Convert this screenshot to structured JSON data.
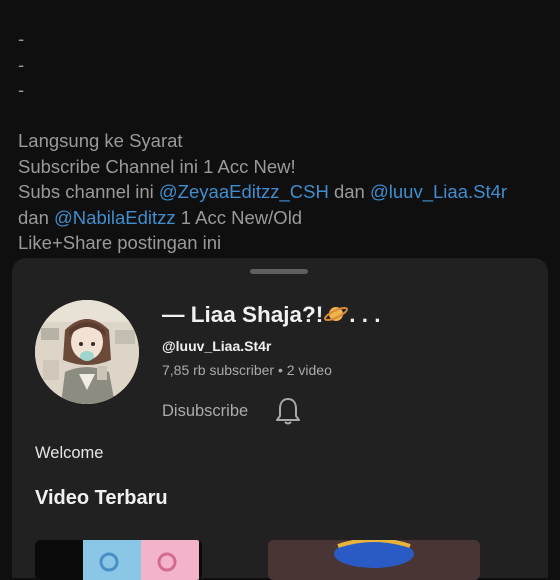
{
  "post": {
    "dashes": [
      "-",
      "-",
      "-"
    ],
    "line1": "Langsung ke Syarat",
    "line2": "Subscribe Channel ini 1 Acc New!",
    "line3_prefix": "Subs channel ini ",
    "mention1": "@ZeyaaEditzz_CSH",
    "line3_mid": " dan ",
    "mention2": "@luuv_Liaa.St4r",
    "line4_prefix": "dan ",
    "mention3": "@NabilaEditzz",
    "line4_suffix": " 1 Acc New/Old",
    "line5": "Like+Share postingan ini"
  },
  "channel": {
    "title": "— Liaa Shaja?!",
    "title_suffix": ". . .",
    "handle": "@luuv_Liaa.St4r",
    "stats": "7,85 rb subscriber • 2 video",
    "unsubscribe_label": "Disubscribe",
    "welcome": "Welcome",
    "section_title": "Video Terbaru"
  },
  "colors": {
    "background": "#0f0f0f",
    "sheet": "#212121",
    "mention": "#3e8ed0",
    "text_primary": "#f1f1f1",
    "text_secondary": "#aaaaaa"
  },
  "icons": {
    "planet": "ringed-planet-emoji",
    "bell": "bell-icon"
  }
}
